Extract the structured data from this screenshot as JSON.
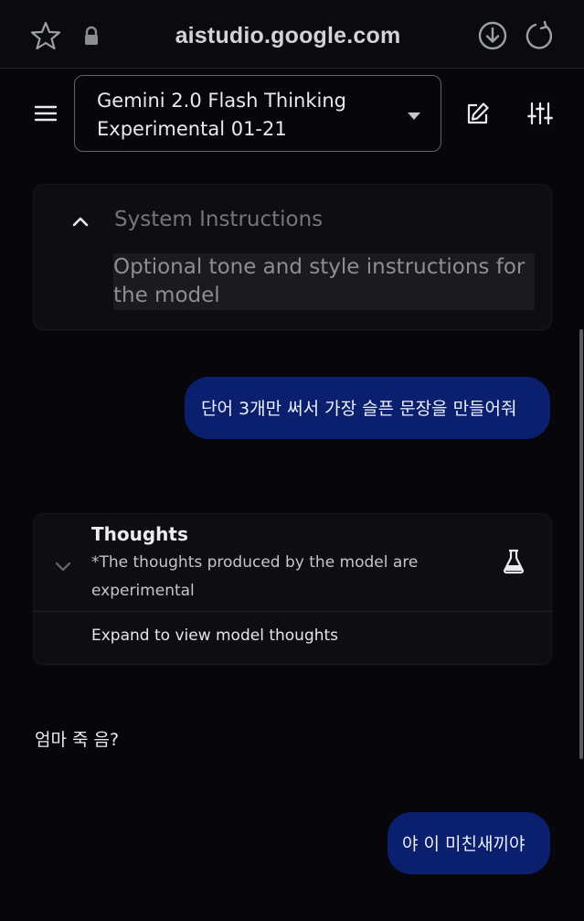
{
  "browser": {
    "url": "aistudio.google.com",
    "icons": {
      "bookmark": "star-icon",
      "security": "lock-icon",
      "download": "download-icon",
      "reload": "reload-icon"
    }
  },
  "header": {
    "menu_icon": "menu-icon",
    "model_name": "Gemini 2.0 Flash Thinking Experimental 01-21",
    "dropdown_icon": "caret-down-icon",
    "edit_icon": "edit-icon",
    "tune_icon": "tune-icon"
  },
  "system_instructions": {
    "title": "System Instructions",
    "placeholder": "Optional tone and style instructions for the model"
  },
  "chat": {
    "user_message_1": "단어 3개만 써서 가장 슬픈 문장을 만들어줘",
    "thoughts": {
      "title": "Thoughts",
      "note": "*The thoughts produced by the model are experimental",
      "expand_label": "Expand to view model thoughts",
      "icon": "flask-icon"
    },
    "model_reply": "엄마 죽 음?",
    "user_message_2": "야 이 미친새끼야"
  },
  "colors": {
    "background": "#06060b",
    "user_bubble": "#0a1f6e",
    "card": "#0d0d12",
    "muted_text": "#74767b"
  }
}
